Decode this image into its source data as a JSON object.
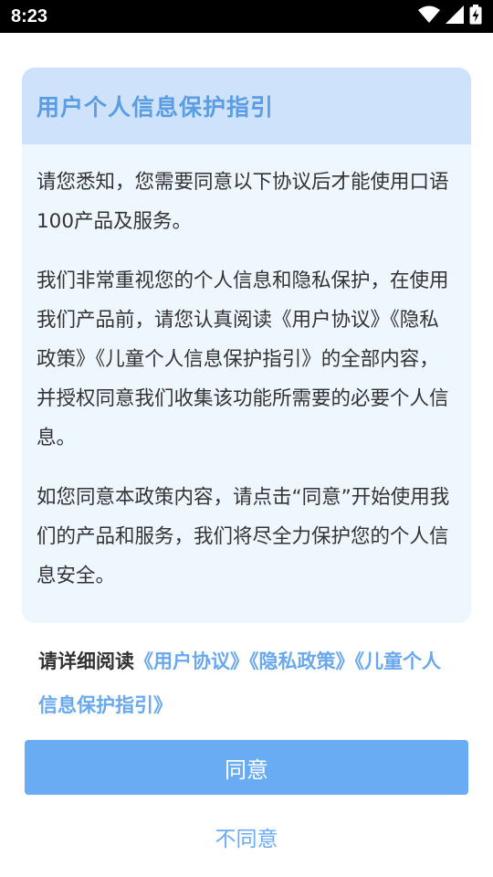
{
  "status_bar": {
    "time": "8:23",
    "icons": [
      "wifi-icon",
      "signal-icon",
      "battery-charging-icon"
    ]
  },
  "dialog": {
    "title": "用户个人信息保护指引",
    "paragraphs": [
      "请您悉知，您需要同意以下协议后才能使用口语100产品及服务。",
      "我们非常重视您的个人信息和隐私保护，在使用我们产品前，请您认真阅读《用户协议》《隐私政策》《儿童个人信息保护指引》的全部内容，并授权同意我们收集该功能所需要的必要个人信息。",
      "如您同意本政策内容，请点击“同意”开始使用我们的产品和服务，我们将尽全力保护您的个人信息安全。"
    ],
    "read_prompt": "请详细阅读",
    "links": {
      "user_agreement": "《用户协议》",
      "privacy_policy": "《隐私政策》",
      "child_privacy_guide": "《儿童个人信息保护指引》"
    },
    "agree_label": "同意",
    "disagree_label": "不同意"
  },
  "colors": {
    "accent": "#6aacf4",
    "header_bg": "#cfe2fb",
    "card_bg": "#eef6fe",
    "title": "#5a9de3"
  }
}
